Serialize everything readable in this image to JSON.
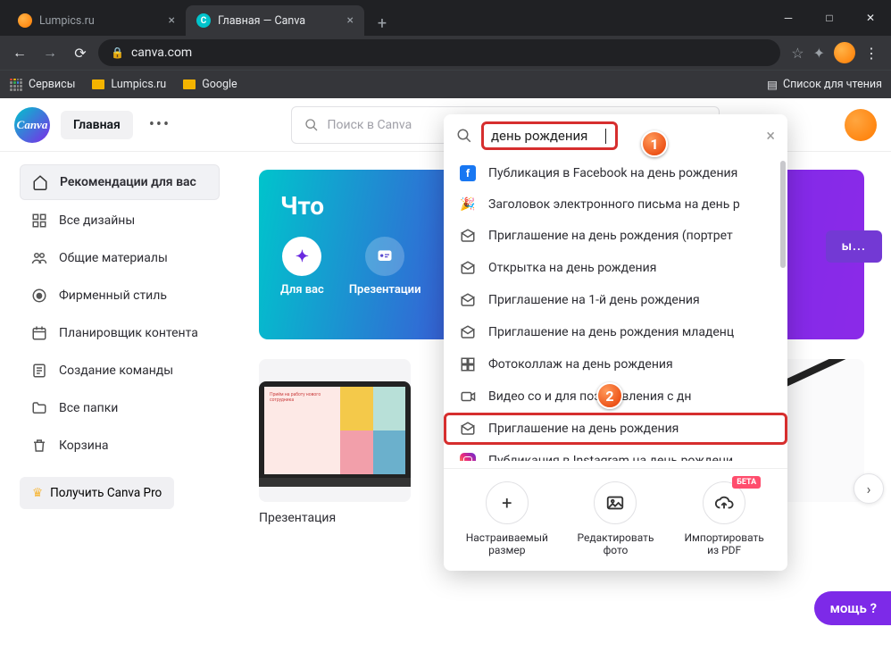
{
  "browser": {
    "tabs": [
      {
        "title": "Lumpics.ru",
        "active": false,
        "favicon_color": "#ff7a00"
      },
      {
        "title": "Главная — Canva",
        "active": true,
        "favicon_letter": "C",
        "favicon_bg": "#00c4cc"
      }
    ],
    "url": "canva.com",
    "bookmarks": {
      "services": "Сервисы",
      "lumpics": "Lumpics.ru",
      "google": "Google",
      "reading_list": "Список для чтения"
    }
  },
  "header": {
    "logo_text": "Canva",
    "home_label": "Главная",
    "search_placeholder": "Поиск в Canva"
  },
  "sidebar": {
    "items": [
      {
        "label": "Рекомендации для вас",
        "icon": "home",
        "active": true
      },
      {
        "label": "Все дизайны",
        "icon": "grid"
      },
      {
        "label": "Общие материалы",
        "icon": "people"
      },
      {
        "label": "Фирменный стиль",
        "icon": "brand"
      },
      {
        "label": "Планировщик контента",
        "icon": "calendar"
      },
      {
        "label": "Создание команды",
        "icon": "team"
      },
      {
        "label": "Все папки",
        "icon": "folder"
      },
      {
        "label": "Корзина",
        "icon": "trash"
      }
    ],
    "pro_label": "Получить Canva Pro"
  },
  "hero": {
    "title_visible": "Что",
    "categories": [
      {
        "label": "Для вас",
        "icon": "✦",
        "active": true
      },
      {
        "label": "Презентации",
        "icon": "▣"
      }
    ],
    "create_btn_visible": "ы..."
  },
  "cards": [
    {
      "title": "Презентация",
      "thumb_text": "Приём на работу нового сотрудника"
    }
  ],
  "dropdown": {
    "query": "день рождения",
    "suggestions": [
      {
        "label": "Публикация в Facebook на день рождения",
        "icon": "facebook"
      },
      {
        "label": "Заголовок электронного письма на день р",
        "icon": "party"
      },
      {
        "label": "Приглашение на день рождения (портрет",
        "icon": "envelope"
      },
      {
        "label": "Открытка на день рождения",
        "icon": "envelope"
      },
      {
        "label": "Приглашение на 1-й день рождения",
        "icon": "envelope"
      },
      {
        "label": "Приглашение на день рождения младенц",
        "icon": "envelope"
      },
      {
        "label": "Фотоколлаж на день рождения",
        "icon": "collage"
      },
      {
        "label": "Видео со               и для поздравления с дн",
        "icon": "video"
      },
      {
        "label": "Приглашение на день рождения",
        "icon": "envelope",
        "highlight": true
      },
      {
        "label": "Публикация в Instagram на день рождени",
        "icon": "instagram"
      }
    ],
    "actions": [
      {
        "label1": "Настраиваемый",
        "label2": "размер",
        "icon": "+"
      },
      {
        "label1": "Редактировать",
        "label2": "фото",
        "icon": "image"
      },
      {
        "label1": "Импортировать",
        "label2": "из PDF",
        "icon": "cloud",
        "badge": "БЕТА"
      }
    ]
  },
  "help_label": "мощь ?",
  "markers": {
    "m1": "1",
    "m2": "2"
  }
}
